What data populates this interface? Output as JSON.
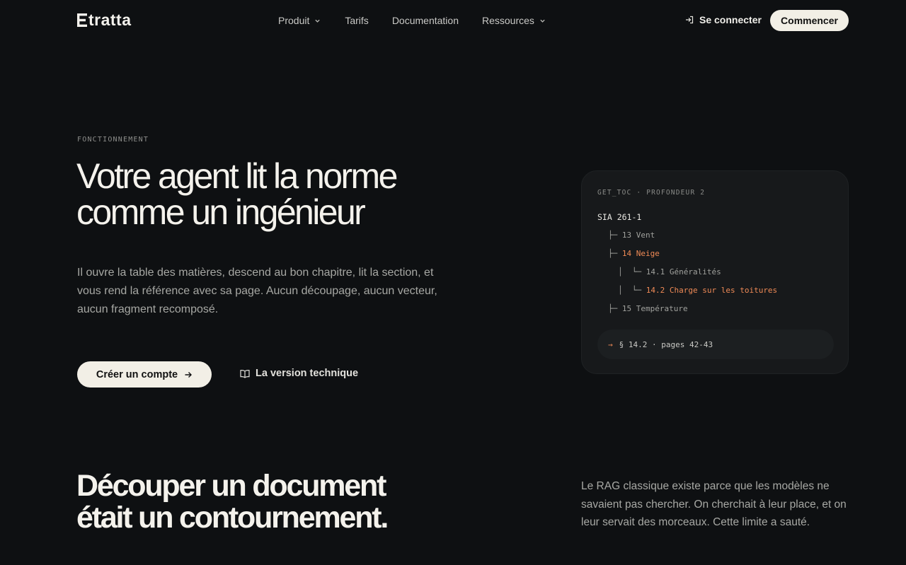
{
  "brand": {
    "name": "tratta"
  },
  "nav": {
    "links": [
      {
        "label": "Produit",
        "has_dropdown": true
      },
      {
        "label": "Tarifs",
        "has_dropdown": false
      },
      {
        "label": "Documentation",
        "has_dropdown": false
      },
      {
        "label": "Ressources",
        "has_dropdown": true
      }
    ],
    "login_label": "Se connecter",
    "cta_label": "Commencer"
  },
  "hero": {
    "eyebrow": "FONCTIONNEMENT",
    "title_line1": "Votre agent lit la norme",
    "title_line2": "comme un ingénieur",
    "description": "Il ouvre la table des matières, descend au bon chapitre, lit la section, et vous rend la référence avec sa page. Aucun découpage, aucun vecteur, aucun fragment recomposé.",
    "primary_button": "Créer un compte",
    "secondary_button": "La version technique"
  },
  "toc_card": {
    "header": "GET_TOC · PROFONDEUR 2",
    "root": "SIA 261-1",
    "items": [
      {
        "prefix": "├─ ",
        "label": "13 Vent",
        "highlight": false
      },
      {
        "prefix": "├─ ",
        "label": "14 Neige",
        "highlight": true
      },
      {
        "prefix": "│  └─ ",
        "label": "14.1 Généralités",
        "highlight": false
      },
      {
        "prefix": "│  └─ ",
        "label": "14.2 Charge sur les toitures",
        "highlight": true
      },
      {
        "prefix": "├─ ",
        "label": "15 Température",
        "highlight": false
      }
    ],
    "result_arrow": "→",
    "result": "§ 14.2 · pages 42-43"
  },
  "section2": {
    "title_line1": "Découper un document",
    "title_line2": "était un contournement.",
    "description": "Le RAG classique existe parce que les modèles ne savaient pas chercher. On cherchait à leur place, et on leur servait des morceaux. Cette limite a sauté."
  },
  "colors": {
    "background": "#0e1012",
    "card": "#17191b",
    "accent": "#ef8a56",
    "button": "#f2efe6"
  },
  "icons": [
    "logo-mark-icon",
    "chevron-down-icon",
    "login-icon",
    "arrow-right-icon",
    "book-icon"
  ]
}
